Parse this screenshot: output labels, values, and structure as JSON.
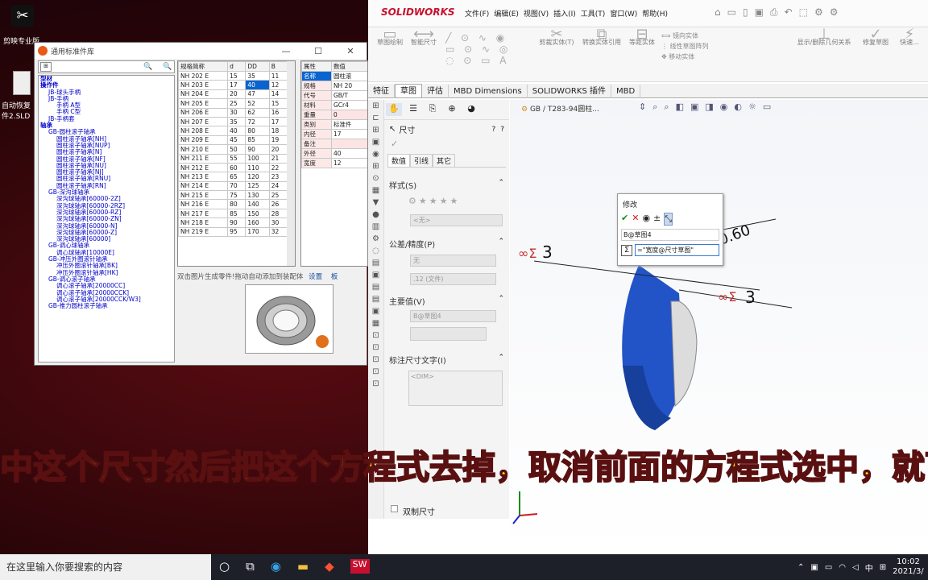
{
  "desktop": {
    "icons": [
      {
        "label": "剪映专业版"
      },
      {
        "label": "自动恢复",
        "label2": "件2.SLD"
      }
    ]
  },
  "tool_window": {
    "title": "通用标准件库",
    "tree": [
      {
        "text": "型材",
        "lv": 0
      },
      {
        "text": "操作件",
        "lv": 0
      },
      {
        "text": "JB-球头手柄",
        "lv": 1
      },
      {
        "text": "JB-手柄",
        "lv": 1
      },
      {
        "text": "手柄 A型",
        "lv": 2
      },
      {
        "text": "手柄 C型",
        "lv": 2
      },
      {
        "text": "JB-手柄套",
        "lv": 1
      },
      {
        "text": "轴承",
        "lv": 0
      },
      {
        "text": "GB-圆柱滚子轴承",
        "lv": 1
      },
      {
        "text": "圆柱滚子轴承[NH]",
        "lv": 2
      },
      {
        "text": "圆柱滚子轴承[NUP]",
        "lv": 2
      },
      {
        "text": "圆柱滚子轴承[N]",
        "lv": 2
      },
      {
        "text": "圆柱滚子轴承[NF]",
        "lv": 2
      },
      {
        "text": "圆柱滚子轴承[NU]",
        "lv": 2
      },
      {
        "text": "圆柱滚子轴承[NJ]",
        "lv": 2
      },
      {
        "text": "圆柱滚子轴承[RNU]",
        "lv": 2
      },
      {
        "text": "圆柱滚子轴承[RN]",
        "lv": 2
      },
      {
        "text": "GB-深沟球轴承",
        "lv": 1
      },
      {
        "text": "深沟球轴承[60000-2Z]",
        "lv": 2
      },
      {
        "text": "深沟球轴承[60000-2RZ]",
        "lv": 2
      },
      {
        "text": "深沟球轴承[60000-RZ]",
        "lv": 2
      },
      {
        "text": "深沟球轴承[60000-ZN]",
        "lv": 2
      },
      {
        "text": "深沟球轴承[60000-N]",
        "lv": 2
      },
      {
        "text": "深沟球轴承[60000-Z]",
        "lv": 2
      },
      {
        "text": "深沟球轴承[60000]",
        "lv": 2
      },
      {
        "text": "GB-调心球轴承",
        "lv": 1
      },
      {
        "text": "调心球轴承[10000E]",
        "lv": 2
      },
      {
        "text": "GB-冲压外圈滚针轴承",
        "lv": 1
      },
      {
        "text": "冲压外圈滚针轴承[BK]",
        "lv": 2
      },
      {
        "text": "冲压外圈滚针轴承[HK]",
        "lv": 2
      },
      {
        "text": "GB-调心滚子轴承",
        "lv": 1
      },
      {
        "text": "调心滚子轴承[20000CC]",
        "lv": 2
      },
      {
        "text": "调心滚子轴承[20000CCK]",
        "lv": 2
      },
      {
        "text": "调心滚子轴承[20000CCK/W3]",
        "lv": 2
      },
      {
        "text": "GB-推力圆柱滚子轴承",
        "lv": 1
      }
    ],
    "spec_table": {
      "headers": [
        "规格简称",
        "d",
        "DD",
        "B"
      ],
      "rows": [
        [
          "NH 202 E",
          "15",
          "35",
          "11"
        ],
        [
          "NH 203 E",
          "17",
          "40",
          "12"
        ],
        [
          "NH 204 E",
          "20",
          "47",
          "14"
        ],
        [
          "NH 205 E",
          "25",
          "52",
          "15"
        ],
        [
          "NH 206 E",
          "30",
          "62",
          "16"
        ],
        [
          "NH 207 E",
          "35",
          "72",
          "17"
        ],
        [
          "NH 208 E",
          "40",
          "80",
          "18"
        ],
        [
          "NH 209 E",
          "45",
          "85",
          "19"
        ],
        [
          "NH 210 E",
          "50",
          "90",
          "20"
        ],
        [
          "NH 211 E",
          "55",
          "100",
          "21"
        ],
        [
          "NH 212 E",
          "60",
          "110",
          "22"
        ],
        [
          "NH 213 E",
          "65",
          "120",
          "23"
        ],
        [
          "NH 214 E",
          "70",
          "125",
          "24"
        ],
        [
          "NH 215 E",
          "75",
          "130",
          "25"
        ],
        [
          "NH 216 E",
          "80",
          "140",
          "26"
        ],
        [
          "NH 217 E",
          "85",
          "150",
          "28"
        ],
        [
          "NH 218 E",
          "90",
          "160",
          "30"
        ],
        [
          "NH 219 E",
          "95",
          "170",
          "32"
        ]
      ],
      "selected_row": 1,
      "selected_col": 2
    },
    "prop_table": {
      "headers": [
        "属性",
        "数值"
      ],
      "rows": [
        [
          "名称",
          "圆柱滚"
        ],
        [
          "规格",
          "NH 20"
        ],
        [
          "代号",
          "GB/T"
        ],
        [
          "材料",
          "GCr4"
        ],
        [
          "重量",
          "0"
        ],
        [
          "类别",
          "标准件"
        ],
        [
          "内径",
          "17"
        ],
        [
          "备注",
          ""
        ],
        [
          "外径",
          "40"
        ],
        [
          "宽度",
          "12"
        ]
      ]
    },
    "hint": "双击图片生成零件!拖动自动添加到装配体",
    "settings_link": "设置",
    "extra_link": "板"
  },
  "solidworks": {
    "brand": "SOLIDWORKS",
    "menus": [
      "文件(F)",
      "编辑(E)",
      "视图(V)",
      "插入(I)",
      "工具(T)",
      "窗口(W)",
      "帮助(H)"
    ],
    "ribbon": [
      {
        "label": "草图绘制"
      },
      {
        "label": "智能尺寸"
      },
      {
        "label": "剪裁实体(T)"
      },
      {
        "label": "转换实体引用"
      },
      {
        "label": "等距实体"
      },
      {
        "label": "镜向实体"
      },
      {
        "label": "线性草图阵列"
      },
      {
        "label": "移动实体"
      },
      {
        "label": "显示/删除几何关系"
      },
      {
        "label": "修复草图"
      },
      {
        "label": "快速..."
      }
    ],
    "tabs": [
      "特征",
      "草图",
      "评估",
      "MBD Dimensions",
      "SOLIDWORKS 插件",
      "MBD"
    ],
    "active_tab": "草图",
    "breadcrumb": "GB / T283-94圆柱...",
    "pm": {
      "title": "尺寸",
      "subtabs": [
        "数值",
        "引线",
        "其它"
      ],
      "style_header": "样式(S)",
      "style_value": "<无>",
      "tol_header": "公差/精度(P)",
      "tol_value": "无",
      "precision_value": ".12 (文件)",
      "primary_header": "主要值(V)",
      "primary_value": "B@草图4",
      "dimtext_header": "标注尺寸文字(I)",
      "dimtext_value": "<DIM>",
      "dual_label": "双制尺寸"
    },
    "modify": {
      "title": "修改",
      "name": "B@草图4",
      "equation": "=\"宽度@尺寸草图\""
    },
    "dims": [
      "3",
      "3",
      "0.60"
    ]
  },
  "subtitle": "中这个尺寸然后把这个方程式去掉，取消前面的方程式选中，就可以",
  "taskbar": {
    "search_placeholder": "在这里输入你要搜索的内容",
    "time": "10:02",
    "date": "2021/3/",
    "ime": "中"
  }
}
